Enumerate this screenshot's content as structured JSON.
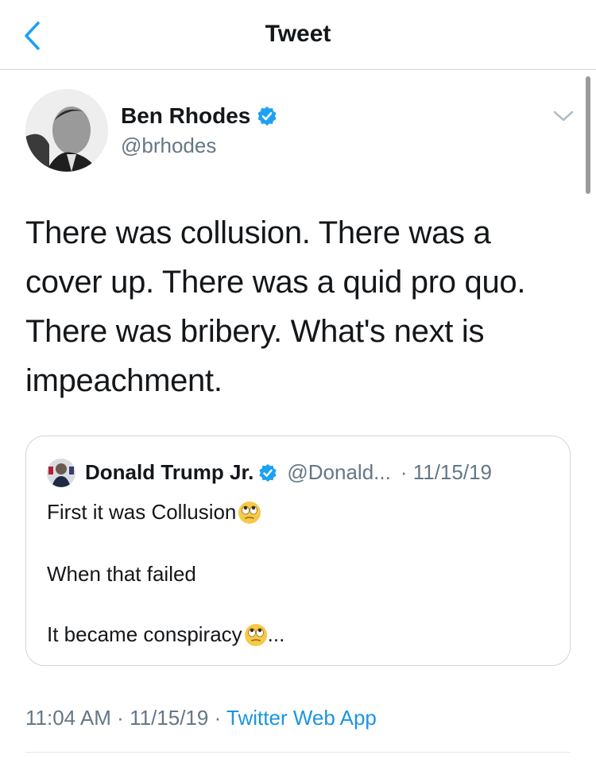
{
  "header": {
    "title": "Tweet",
    "back_icon": "chevron-left-icon"
  },
  "colors": {
    "accent": "#1b95e0",
    "secondary_text": "#657786",
    "verified": "#1da1f2"
  },
  "tweet": {
    "author": {
      "name": "Ben Rhodes",
      "handle": "@brhodes",
      "verified": true
    },
    "lines": [
      "There was collusion. There was a",
      "cover up. There was a quid pro quo.",
      "There was bribery. What's next is",
      "impeachment."
    ],
    "time": "11:04 AM",
    "date": "11/15/19",
    "source": "Twitter Web App",
    "separator": "·"
  },
  "quoted": {
    "author": {
      "name": "Donald Trump Jr.",
      "handle": "@Donald...",
      "verified": true
    },
    "date": "· 11/15/19",
    "lines": [
      {
        "text": "First it was Collusion",
        "emoji": "eye-roll-emoji",
        "suffix": ""
      },
      {
        "text": "When that failed",
        "emoji": "",
        "suffix": ""
      },
      {
        "text": "It became conspiracy",
        "emoji": "eye-roll-emoji",
        "suffix": "..."
      }
    ]
  }
}
